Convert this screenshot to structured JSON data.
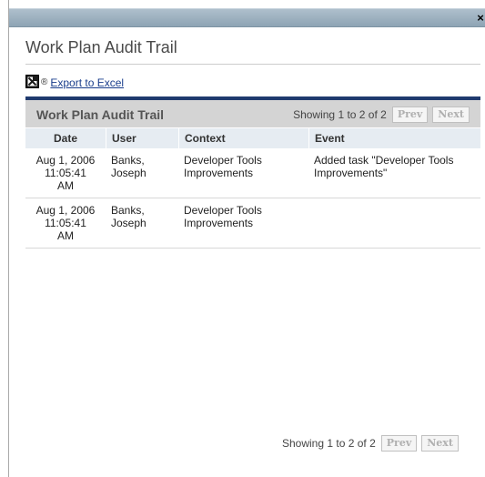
{
  "window": {
    "close_label": "×"
  },
  "page": {
    "title": "Work Plan Audit Trail"
  },
  "export": {
    "reg_mark": "®",
    "link_label": "Export to Excel"
  },
  "panel": {
    "title": "Work Plan Audit Trail",
    "showing": "Showing 1 to 2 of 2",
    "prev_label": "Prev",
    "next_label": "Next"
  },
  "table": {
    "columns": [
      "Date",
      "User",
      "Context",
      "Event"
    ],
    "rows": [
      {
        "date_line1": "Aug 1, 2006",
        "date_line2": "11:05:41",
        "date_line3": "AM",
        "user_line1": "Banks,",
        "user_line2": "Joseph",
        "context_line1": "Developer Tools",
        "context_line2": "Improvements",
        "event_line1": "Added task \"Developer Tools",
        "event_line2": "Improvements\""
      },
      {
        "date_line1": "Aug 1, 2006",
        "date_line2": "11:05:41",
        "date_line3": "AM",
        "user_line1": "Banks,",
        "user_line2": "Joseph",
        "context_line1": "Developer Tools",
        "context_line2": "Improvements",
        "event_line1": "",
        "event_line2": ""
      }
    ]
  },
  "bottom_pager": {
    "showing": "Showing 1 to 2 of 2",
    "prev_label": "Prev",
    "next_label": "Next"
  },
  "icons": {
    "excel": "excel-icon",
    "close": "close-icon"
  },
  "colors": {
    "title_bar": "#9fb2c1",
    "accent_rule": "#1f3a6e",
    "header_bg": "#d4d4d4",
    "column_header_bg": "#e6ecf2",
    "link": "#1a3e8c"
  }
}
